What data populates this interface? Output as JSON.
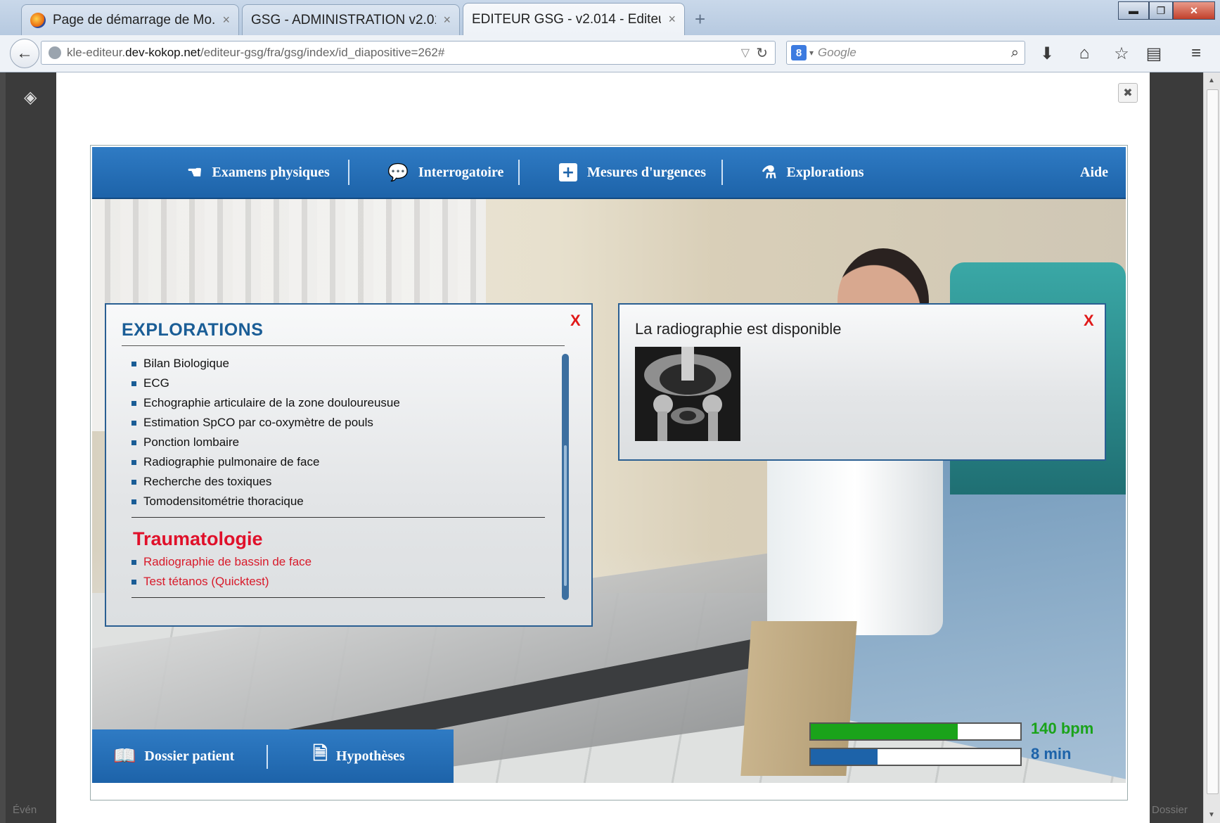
{
  "browser": {
    "tabs": [
      {
        "label": "Page de démarrage de Mo...",
        "active": false
      },
      {
        "label": "GSG - ADMINISTRATION v2.01...",
        "active": false
      },
      {
        "label": "EDITEUR GSG - v2.014 - Editeur ...",
        "active": true
      }
    ],
    "new_tab_symbol": "+",
    "close_symbol": "×",
    "url": {
      "prefix": "kle-editeur.",
      "host": "dev-kokop.net",
      "path": "/editeur-gsg/fra/gsg/index/id_diapositive=262#"
    },
    "search_placeholder": "Google",
    "window_controls": [
      "minimize",
      "maximize",
      "close"
    ],
    "toolbar_icons": [
      "download-icon",
      "home-icon",
      "bookmark-star-icon",
      "reader-icon",
      "menu-icon"
    ]
  },
  "game": {
    "nav": [
      {
        "label": "Examens physiques",
        "icon": "hand-icon"
      },
      {
        "label": "Interrogatoire",
        "icon": "speech-bubbles-icon"
      },
      {
        "label": "Mesures d'urgences",
        "icon": "first-aid-cross-icon"
      },
      {
        "label": "Explorations",
        "icon": "flask-icon"
      },
      {
        "label": "Aide",
        "icon": ""
      }
    ],
    "explorations": {
      "title": "EXPLORATIONS",
      "close": "X",
      "items": [
        "Bilan Biologique",
        "ECG",
        "Echographie articulaire de la zone douloureusue",
        "Estimation SpCO par co-oxymètre de pouls",
        "Ponction lombaire",
        "Radiographie pulmonaire de face",
        "Recherche des toxiques",
        "Tomodensitométrie thoracique"
      ],
      "section_title": "Traumatologie",
      "section_items": [
        "Radiographie de bassin de face",
        "Test tétanos (Quicktest)"
      ]
    },
    "result": {
      "message": "La radiographie est disponible",
      "close": "X"
    },
    "bottom_nav": [
      {
        "label": "Dossier patient",
        "icon": "book-icon"
      },
      {
        "label": "Hypothèses",
        "icon": "document-icon"
      }
    ],
    "vitals": [
      {
        "label": "140 bpm",
        "fill_fraction": 0.7,
        "color": "#1aa31a"
      },
      {
        "label": "8 min",
        "fill_fraction": 0.32,
        "color": "#1d63a9"
      }
    ]
  },
  "modal_close": "✖",
  "faded_left": "Évén",
  "faded_right": "Dossier"
}
